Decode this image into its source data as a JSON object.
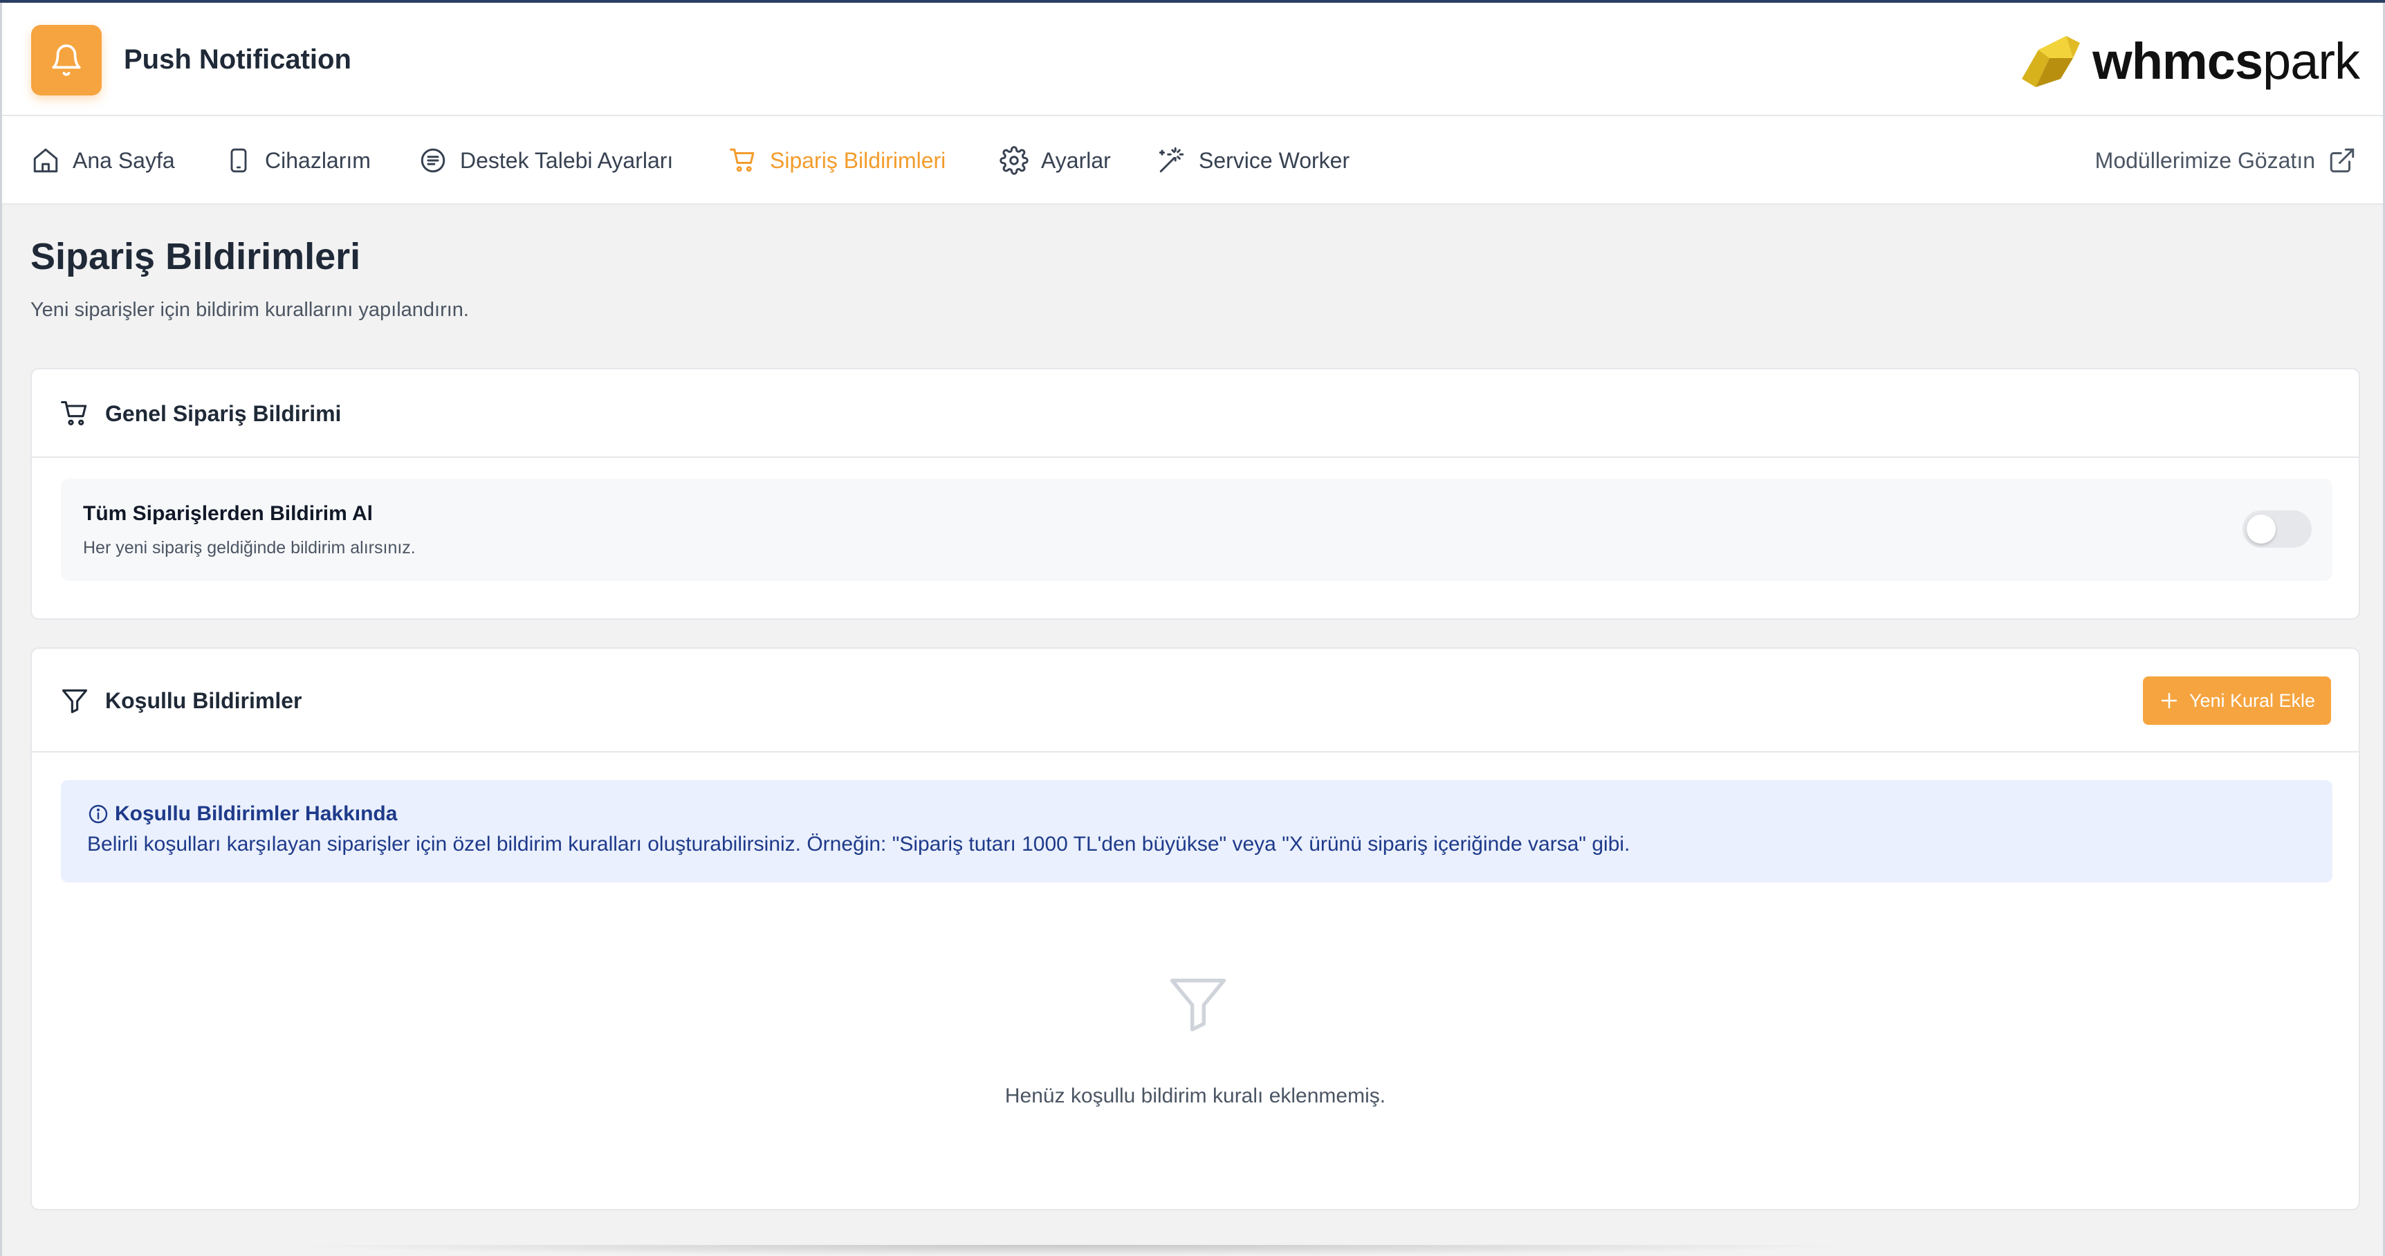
{
  "header": {
    "app_title": "Push Notification",
    "app_icon": "bell-icon",
    "brand_bold": "whmcs",
    "brand_light": "park"
  },
  "nav": {
    "items": [
      {
        "label": "Ana Sayfa",
        "icon": "home-icon",
        "active": false
      },
      {
        "label": "Cihazlarım",
        "icon": "smartphone-icon",
        "active": false
      },
      {
        "label": "Destek Talebi Ayarları",
        "icon": "ticket-icon",
        "active": false
      },
      {
        "label": "Sipariş Bildirimleri",
        "icon": "cart-icon",
        "active": true
      },
      {
        "label": "Ayarlar",
        "icon": "gear-icon",
        "active": false
      },
      {
        "label": "Service Worker",
        "icon": "magic-wand-icon",
        "active": false
      }
    ],
    "right_link": "Modüllerimize Gözatın"
  },
  "page": {
    "title": "Sipariş Bildirimleri",
    "subtitle": "Yeni siparişler için bildirim kurallarını yapılandırın."
  },
  "general_card": {
    "title": "Genel Sipariş Bildirimi",
    "setting_title": "Tüm Siparişlerden Bildirim Al",
    "setting_desc": "Her yeni sipariş geldiğinde bildirim alırsınız.",
    "toggle_on": false
  },
  "conditional_card": {
    "title": "Koşullu Bildirimler",
    "add_button": "Yeni Kural Ekle",
    "info_title": "Koşullu Bildirimler Hakkında",
    "info_text": "Belirli koşulları karşılayan siparişler için özel bildirim kuralları oluşturabilirsiniz. Örneğin: \"Sipariş tutarı 1000 TL'den büyükse\" veya \"X ürünü sipariş içeriğinde varsa\" gibi.",
    "empty_text": "Henüz koşullu bildirim kuralı eklenmemiş."
  },
  "colors": {
    "accent": "#f6a43f",
    "info_bg": "#eaf0fd",
    "info_text": "#1e3a8a"
  }
}
